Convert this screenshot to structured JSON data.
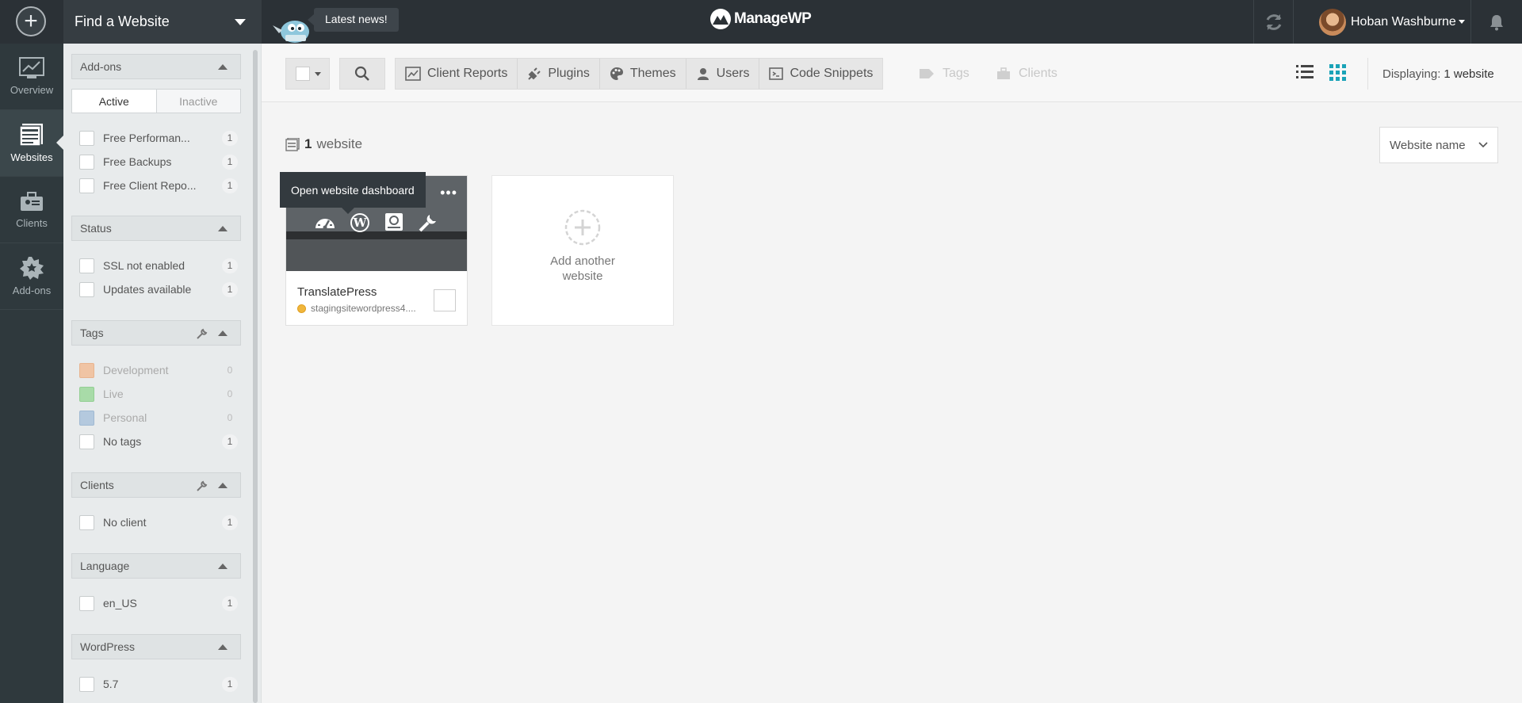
{
  "topbar": {
    "find_label": "Find a Website",
    "news_label": "Latest news!",
    "logo_text": "ManageWP",
    "user_name": "Hoban Washburne"
  },
  "nav": {
    "items": [
      {
        "label": "Overview",
        "icon": "chart-icon",
        "active": false
      },
      {
        "label": "Websites",
        "icon": "websites-icon",
        "active": true
      },
      {
        "label": "Clients",
        "icon": "clients-icon",
        "active": false
      },
      {
        "label": "Add-ons",
        "icon": "addons-icon",
        "active": false
      }
    ]
  },
  "filters": {
    "addons": {
      "title": "Add-ons",
      "tab_active": "Active",
      "tab_inactive": "Inactive",
      "items": [
        {
          "label": "Free Performan...",
          "count": "1"
        },
        {
          "label": "Free Backups",
          "count": "1"
        },
        {
          "label": "Free Client Repo...",
          "count": "1"
        }
      ]
    },
    "status": {
      "title": "Status",
      "items": [
        {
          "label": "SSL not enabled",
          "count": "1"
        },
        {
          "label": "Updates available",
          "count": "1"
        }
      ]
    },
    "tags": {
      "title": "Tags",
      "items": [
        {
          "label": "Development",
          "count": "0",
          "color": "#f0c4a4"
        },
        {
          "label": "Live",
          "count": "0",
          "color": "#a8dba8"
        },
        {
          "label": "Personal",
          "count": "0",
          "color": "#b4c9de"
        },
        {
          "label": "No tags",
          "count": "1"
        }
      ]
    },
    "clients": {
      "title": "Clients",
      "items": [
        {
          "label": "No client",
          "count": "1"
        }
      ]
    },
    "language": {
      "title": "Language",
      "items": [
        {
          "label": "en_US",
          "count": "1"
        }
      ]
    },
    "wordpress": {
      "title": "WordPress",
      "items": [
        {
          "label": "5.7",
          "count": "1"
        }
      ]
    }
  },
  "toolbar": {
    "client_reports": "Client Reports",
    "plugins": "Plugins",
    "themes": "Themes",
    "users": "Users",
    "code_snippets": "Code Snippets",
    "tags": "Tags",
    "clients": "Clients",
    "displaying_label": "Displaying:",
    "displaying_value": "1 website"
  },
  "main": {
    "count_num": "1",
    "count_label": "website",
    "sort_value": "Website name",
    "site": {
      "name": "TranslatePress",
      "url": "stagingsitewordpress4....",
      "tooltip": "Open website dashboard"
    },
    "add_card_text": "Add another website"
  },
  "colors": {
    "accent": "#1aa3b8",
    "status_dot": "#f0b63c"
  }
}
